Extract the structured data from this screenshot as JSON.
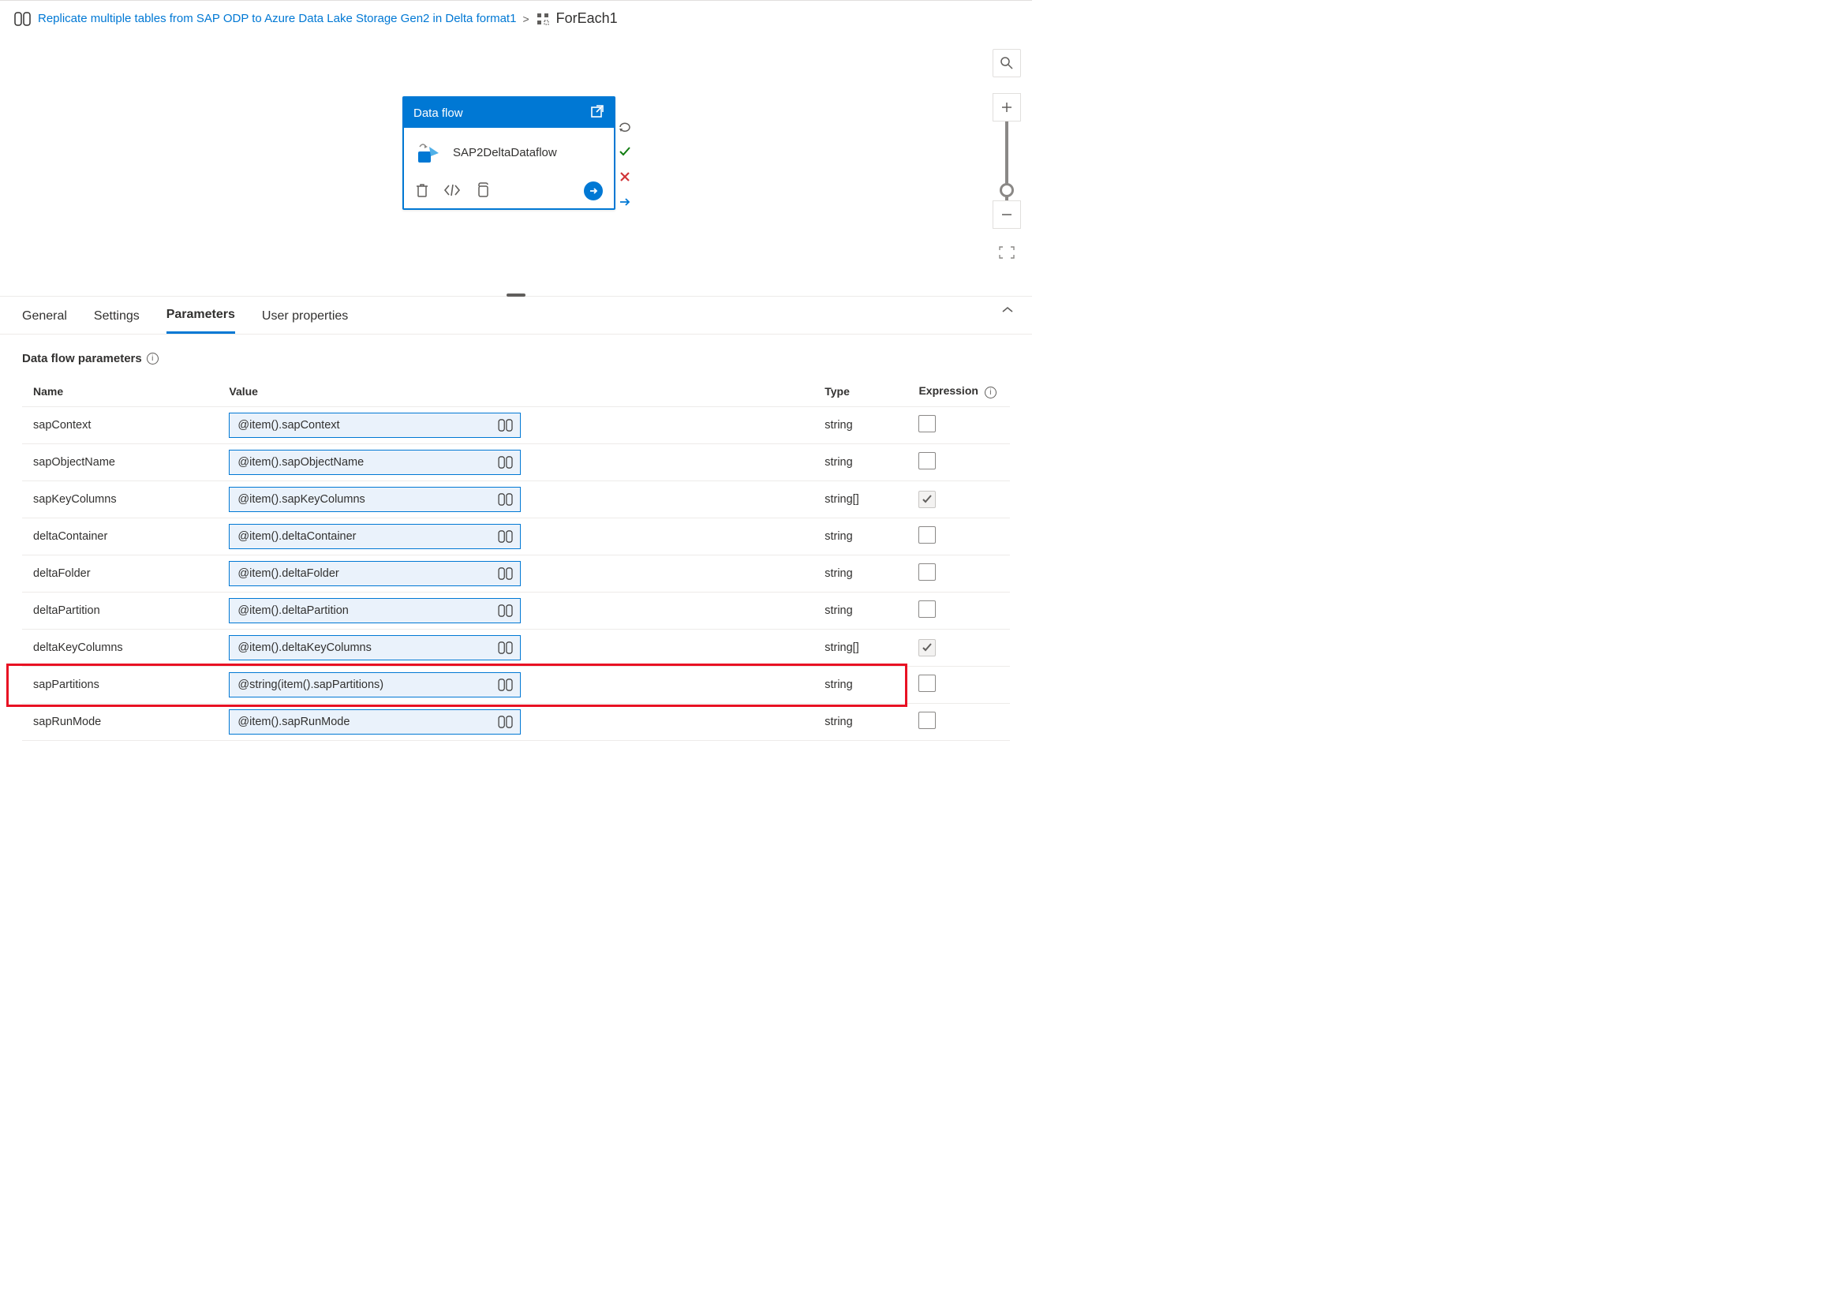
{
  "breadcrumb": {
    "link_label": "Replicate multiple tables from SAP ODP to Azure Data Lake Storage Gen2 in Delta format1",
    "current": "ForEach1"
  },
  "activity": {
    "header": "Data flow",
    "name": "SAP2DeltaDataflow"
  },
  "tabs": {
    "general": "General",
    "settings": "Settings",
    "parameters": "Parameters",
    "user_properties": "User properties"
  },
  "section": {
    "title": "Data flow parameters",
    "columns": {
      "name": "Name",
      "value": "Value",
      "type": "Type",
      "expression": "Expression"
    }
  },
  "params": [
    {
      "name": "sapContext",
      "value": "@item().sapContext",
      "type": "string",
      "checked": false
    },
    {
      "name": "sapObjectName",
      "value": "@item().sapObjectName",
      "type": "string",
      "checked": false
    },
    {
      "name": "sapKeyColumns",
      "value": "@item().sapKeyColumns",
      "type": "string[]",
      "checked": true
    },
    {
      "name": "deltaContainer",
      "value": "@item().deltaContainer",
      "type": "string",
      "checked": false
    },
    {
      "name": "deltaFolder",
      "value": "@item().deltaFolder",
      "type": "string",
      "checked": false
    },
    {
      "name": "deltaPartition",
      "value": "@item().deltaPartition",
      "type": "string",
      "checked": false
    },
    {
      "name": "deltaKeyColumns",
      "value": "@item().deltaKeyColumns",
      "type": "string[]",
      "checked": true
    },
    {
      "name": "sapPartitions",
      "value": "@string(item().sapPartitions)",
      "type": "string",
      "checked": false,
      "highlight": true
    },
    {
      "name": "sapRunMode",
      "value": "@item().sapRunMode",
      "type": "string",
      "checked": false
    }
  ]
}
